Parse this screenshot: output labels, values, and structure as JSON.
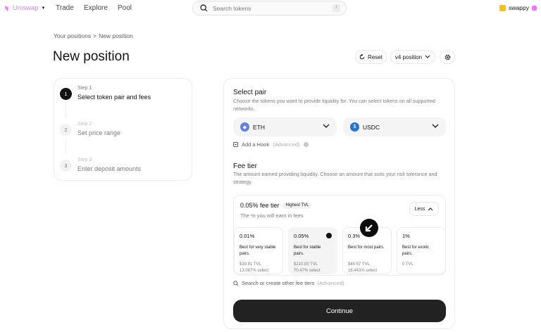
{
  "nav": {
    "brand": "Uniswap",
    "links": [
      "Trade",
      "Explore",
      "Pool"
    ],
    "search_placeholder": "Search tokens",
    "search_shortcut": "/",
    "account_name": "swappy"
  },
  "header": {
    "breadcrumb_root": "Your positions",
    "breadcrumb_sep": ">",
    "breadcrumb_current": "New position",
    "title": "New position",
    "reset_label": "Reset",
    "version_label": "v4 position"
  },
  "steps": [
    {
      "num": "1",
      "small": "Step 1",
      "label": "Select token pair and fees"
    },
    {
      "num": "2",
      "small": "Step 2",
      "label": "Set price range"
    },
    {
      "num": "3",
      "small": "Step 3",
      "label": "Enter deposit amounts"
    }
  ],
  "pair": {
    "title": "Select pair",
    "desc": "Choose the tokens you want to provide liquidity for. You can select tokens on all supported networks.",
    "token_a": "ETH",
    "token_b": "USDC",
    "hook_label": "Add a Hook",
    "hook_tag": "(Advanced)"
  },
  "fee": {
    "title": "Fee tier",
    "desc": "The amount earned providing liquidity. Choose an amount that suits your risk tolerance and strategy.",
    "selected_label": "0.05% fee tier",
    "badge": "Highest TVL",
    "earn": "The % you will earn in fees",
    "less_label": "Less",
    "tiers": [
      {
        "pct": "0.01%",
        "best": "Best for very stable pairs.",
        "tvl": "$39.81 TVL",
        "select": "13.087% select"
      },
      {
        "pct": "0.05%",
        "best": "Best for stable pairs.",
        "tvl": "$210.00 TVL",
        "select": "70.47% select"
      },
      {
        "pct": "0.3%",
        "best": "Best for most pairs.",
        "tvl": "$49.57 TVL",
        "select": "16.443% select"
      },
      {
        "pct": "1%",
        "best": "Best for exotic pairs.",
        "tvl": "0 TVL",
        "select": ""
      }
    ],
    "other_label": "Search or create other fee tiers",
    "other_tag": "(Advanced)"
  },
  "continue_label": "Continue",
  "colors": {
    "brand": "#fc72ff",
    "eth": "#627eea",
    "usdc": "#2775ca",
    "button": "#222222"
  }
}
